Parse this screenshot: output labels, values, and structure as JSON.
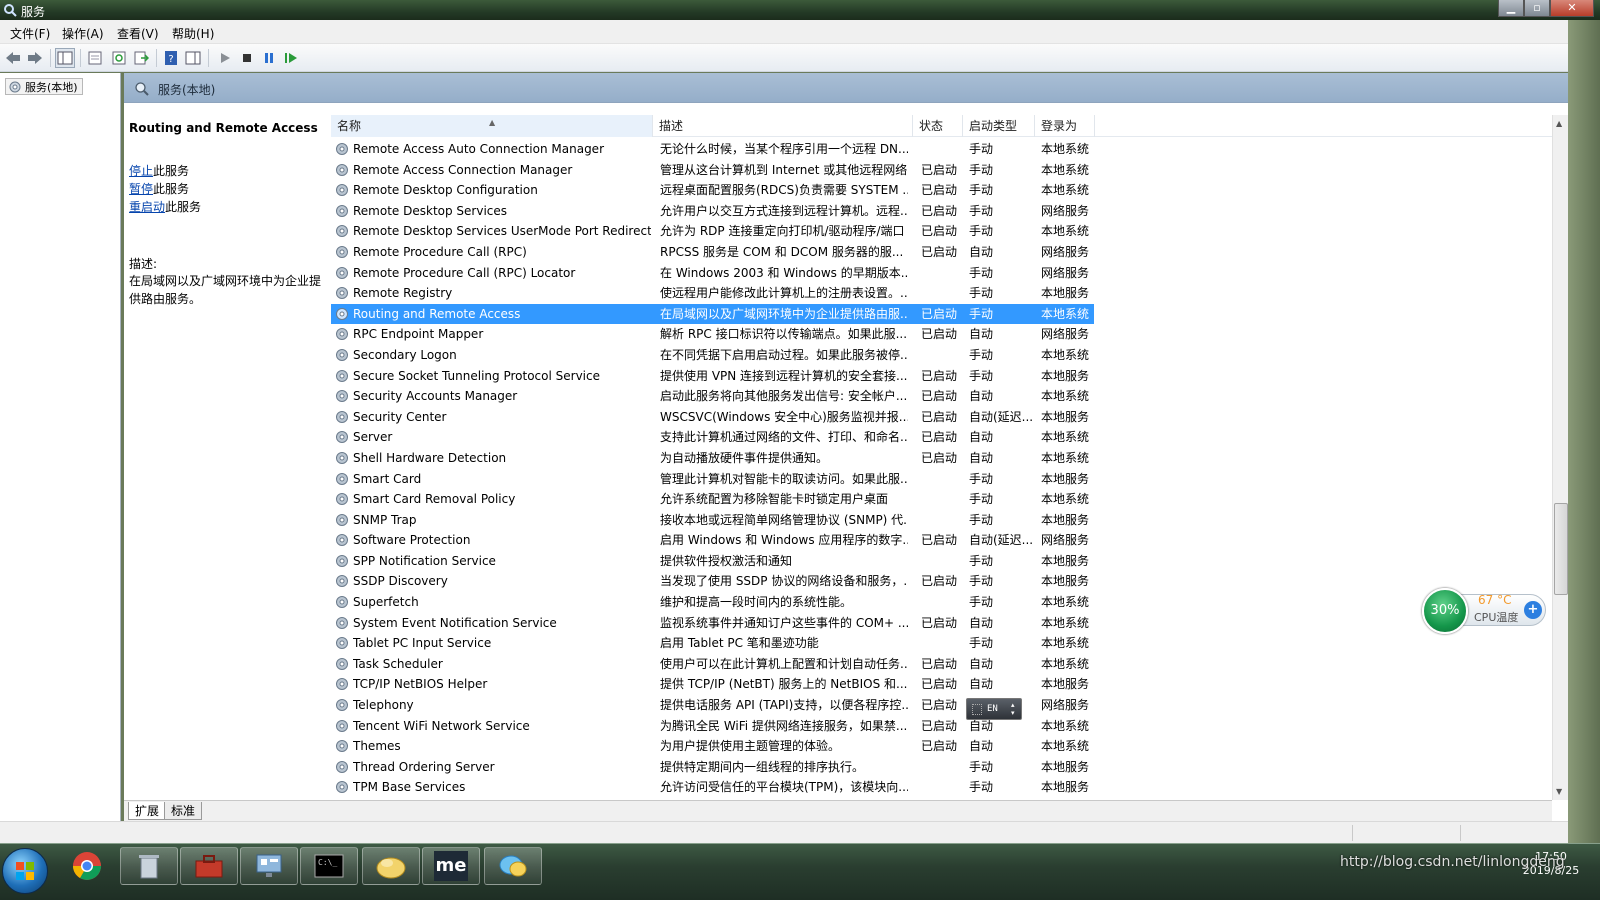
{
  "window": {
    "title": "服务"
  },
  "menu": [
    "文件(F)",
    "操作(A)",
    "查看(V)",
    "帮助(H)"
  ],
  "tree": {
    "root": "服务(本地)"
  },
  "panel_header": "服务(本地)",
  "detail": {
    "title": "Routing and Remote Access",
    "actions": [
      {
        "link": "停止",
        "suffix": "此服务"
      },
      {
        "link": "暂停",
        "suffix": "此服务"
      },
      {
        "link": "重启动",
        "suffix": "此服务"
      }
    ],
    "desc_label": "描述:",
    "desc_text": "在局域网以及广域网环境中为企业提供路由服务。"
  },
  "columns": [
    "名称",
    "描述",
    "状态",
    "启动类型",
    "登录为"
  ],
  "services": [
    {
      "name": "Remote Access Auto Connection Manager",
      "desc": "无论什么时候，当某个程序引用一个远程 DN...",
      "status": "",
      "startup": "手动",
      "logon": "本地系统"
    },
    {
      "name": "Remote Access Connection Manager",
      "desc": "管理从这台计算机到 Internet 或其他远程网络...",
      "status": "已启动",
      "startup": "手动",
      "logon": "本地系统"
    },
    {
      "name": "Remote Desktop Configuration",
      "desc": "远程桌面配置服务(RDCS)负责需要 SYSTEM ...",
      "status": "已启动",
      "startup": "手动",
      "logon": "本地系统"
    },
    {
      "name": "Remote Desktop Services",
      "desc": "允许用户以交互方式连接到远程计算机。远程...",
      "status": "已启动",
      "startup": "手动",
      "logon": "网络服务"
    },
    {
      "name": "Remote Desktop Services UserMode Port Redirect...",
      "desc": "允许为 RDP 连接重定向打印机/驱动程序/端口",
      "status": "已启动",
      "startup": "手动",
      "logon": "本地系统"
    },
    {
      "name": "Remote Procedure Call (RPC)",
      "desc": "RPCSS 服务是 COM 和 DCOM 服务器的服...",
      "status": "已启动",
      "startup": "自动",
      "logon": "网络服务"
    },
    {
      "name": "Remote Procedure Call (RPC) Locator",
      "desc": "在 Windows 2003 和 Windows 的早期版本...",
      "status": "",
      "startup": "手动",
      "logon": "网络服务"
    },
    {
      "name": "Remote Registry",
      "desc": "使远程用户能修改此计算机上的注册表设置。...",
      "status": "",
      "startup": "手动",
      "logon": "本地服务"
    },
    {
      "name": "Routing and Remote Access",
      "desc": "在局域网以及广域网环境中为企业提供路由服...",
      "status": "已启动",
      "startup": "手动",
      "logon": "本地系统",
      "selected": true
    },
    {
      "name": "RPC Endpoint Mapper",
      "desc": "解析 RPC 接口标识符以传输端点。如果此服...",
      "status": "已启动",
      "startup": "自动",
      "logon": "网络服务"
    },
    {
      "name": "Secondary Logon",
      "desc": "在不同凭据下启用启动过程。如果此服务被停...",
      "status": "",
      "startup": "手动",
      "logon": "本地系统"
    },
    {
      "name": "Secure Socket Tunneling Protocol Service",
      "desc": "提供使用 VPN 连接到远程计算机的安全套接...",
      "status": "已启动",
      "startup": "手动",
      "logon": "本地服务"
    },
    {
      "name": "Security Accounts Manager",
      "desc": "启动此服务将向其他服务发出信号: 安全帐户...",
      "status": "已启动",
      "startup": "自动",
      "logon": "本地系统"
    },
    {
      "name": "Security Center",
      "desc": "WSCSVC(Windows 安全中心)服务监视并报...",
      "status": "已启动",
      "startup": "自动(延迟...",
      "logon": "本地服务"
    },
    {
      "name": "Server",
      "desc": "支持此计算机通过网络的文件、打印、和命名...",
      "status": "已启动",
      "startup": "自动",
      "logon": "本地系统"
    },
    {
      "name": "Shell Hardware Detection",
      "desc": "为自动播放硬件事件提供通知。",
      "status": "已启动",
      "startup": "自动",
      "logon": "本地系统"
    },
    {
      "name": "Smart Card",
      "desc": "管理此计算机对智能卡的取读访问。如果此服...",
      "status": "",
      "startup": "手动",
      "logon": "本地服务"
    },
    {
      "name": "Smart Card Removal Policy",
      "desc": "允许系统配置为移除智能卡时锁定用户桌面",
      "status": "",
      "startup": "手动",
      "logon": "本地系统"
    },
    {
      "name": "SNMP Trap",
      "desc": "接收本地或远程简单网络管理协议 (SNMP) 代...",
      "status": "",
      "startup": "手动",
      "logon": "本地服务"
    },
    {
      "name": "Software Protection",
      "desc": "启用 Windows 和 Windows 应用程序的数字...",
      "status": "已启动",
      "startup": "自动(延迟...",
      "logon": "网络服务"
    },
    {
      "name": "SPP Notification Service",
      "desc": "提供软件授权激活和通知",
      "status": "",
      "startup": "手动",
      "logon": "本地服务"
    },
    {
      "name": "SSDP Discovery",
      "desc": "当发现了使用 SSDP 协议的网络设备和服务，...",
      "status": "已启动",
      "startup": "手动",
      "logon": "本地服务"
    },
    {
      "name": "Superfetch",
      "desc": "维护和提高一段时间内的系统性能。",
      "status": "",
      "startup": "手动",
      "logon": "本地系统"
    },
    {
      "name": "System Event Notification Service",
      "desc": "监视系统事件并通知订户这些事件的 COM+ ...",
      "status": "已启动",
      "startup": "自动",
      "logon": "本地系统"
    },
    {
      "name": "Tablet PC Input Service",
      "desc": "启用 Tablet PC 笔和墨迹功能",
      "status": "",
      "startup": "手动",
      "logon": "本地系统"
    },
    {
      "name": "Task Scheduler",
      "desc": "使用户可以在此计算机上配置和计划自动任务...",
      "status": "已启动",
      "startup": "自动",
      "logon": "本地系统"
    },
    {
      "name": "TCP/IP NetBIOS Helper",
      "desc": "提供 TCP/IP (NetBT) 服务上的 NetBIOS 和...",
      "status": "已启动",
      "startup": "自动",
      "logon": "本地服务"
    },
    {
      "name": "Telephony",
      "desc": "提供电话服务 API (TAPI)支持，以便各程序控...",
      "status": "已启动",
      "startup": "",
      "logon": "网络服务"
    },
    {
      "name": "Tencent WiFi Network Service",
      "desc": "为腾讯全民 WiFi 提供网络连接服务，如果禁...",
      "status": "已启动",
      "startup": "自动",
      "logon": "本地系统"
    },
    {
      "name": "Themes",
      "desc": "为用户提供使用主题管理的体验。",
      "status": "已启动",
      "startup": "自动",
      "logon": "本地系统"
    },
    {
      "name": "Thread Ordering Server",
      "desc": "提供特定期间内一组线程的排序执行。",
      "status": "",
      "startup": "手动",
      "logon": "本地服务"
    },
    {
      "name": "TPM Base Services",
      "desc": "允许访问受信任的平台模块(TPM)，该模块向...",
      "status": "",
      "startup": "手动",
      "logon": "本地服务"
    }
  ],
  "tabs": [
    "扩展",
    "标准"
  ],
  "cpu_widget": {
    "percent": "30%",
    "temp": "67 °C",
    "label": "CPU温度"
  },
  "ime": {
    "text": "EN"
  },
  "taskbar": {
    "apps": [
      "chrome-icon",
      "recycle-icon",
      "toolbox-icon",
      "network-icon",
      "cmd-icon",
      "folder-icon",
      "me-icon",
      "qq-icon"
    ],
    "me_label": "me"
  },
  "clock": {
    "time": "17:50",
    "date": "2019/8/25"
  },
  "watermark": "http://blog.csdn.net/linlongdeng",
  "colors": {
    "selection": "#3399ff",
    "link": "#0645ad",
    "header_bar": "#a9bed5"
  }
}
